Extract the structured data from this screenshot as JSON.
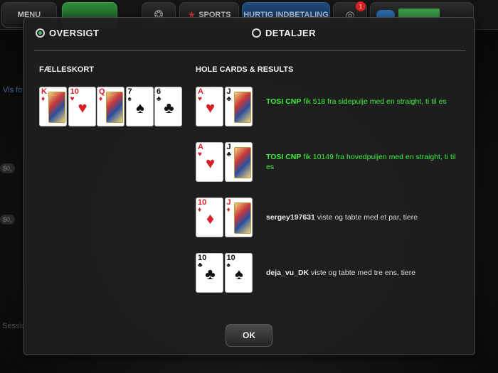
{
  "topbar": {
    "menu_label": "MENU",
    "sports_label": "SPORTS",
    "quick_deposit_label": "HURTIG INDBETALING",
    "notification_count": "1"
  },
  "background": {
    "show_link": "Vis fo",
    "session_label": "Sessio",
    "chip_left_1": "$0,",
    "chip_left_2": "$0,"
  },
  "dialog": {
    "tabs": [
      {
        "label": "OVERSIGT",
        "selected": true
      },
      {
        "label": "DETALJER",
        "selected": false
      }
    ],
    "board_heading": "FÆLLESKORT",
    "hole_heading": "HOLE CARDS & RESULTS",
    "board_cards": [
      {
        "rank": "K",
        "suit": "♦",
        "color": "red",
        "face": true
      },
      {
        "rank": "10",
        "suit": "♥",
        "color": "red",
        "face": false
      },
      {
        "rank": "Q",
        "suit": "♦",
        "color": "red",
        "face": true
      },
      {
        "rank": "7",
        "suit": "♠",
        "color": "blk",
        "face": false
      },
      {
        "rank": "6",
        "suit": "♣",
        "color": "blk",
        "face": false
      }
    ],
    "results": [
      {
        "cards": [
          {
            "rank": "A",
            "suit": "♥",
            "color": "red",
            "face": false
          },
          {
            "rank": "J",
            "suit": "♣",
            "color": "blk",
            "face": true
          }
        ],
        "player": "TOSI CNP",
        "text": " fik 518 fra sidepulje med en straight, ti til es",
        "winner": true
      },
      {
        "cards": [
          {
            "rank": "A",
            "suit": "♥",
            "color": "red",
            "face": false
          },
          {
            "rank": "J",
            "suit": "♣",
            "color": "blk",
            "face": true
          }
        ],
        "player": "TOSI CNP",
        "text": " fik 10149 fra hovedpuljen med en straight, ti til es",
        "winner": true
      },
      {
        "cards": [
          {
            "rank": "10",
            "suit": "♦",
            "color": "red",
            "face": false
          },
          {
            "rank": "J",
            "suit": "♦",
            "color": "red",
            "face": true
          }
        ],
        "player": "sergey197631",
        "text": " viste og tabte med et par, tiere",
        "winner": false
      },
      {
        "cards": [
          {
            "rank": "10",
            "suit": "♣",
            "color": "blk",
            "face": false
          },
          {
            "rank": "10",
            "suit": "♠",
            "color": "blk",
            "face": false
          }
        ],
        "player": "deja_vu_DK",
        "text": " viste og tabte med tre ens, tiere",
        "winner": false
      }
    ],
    "ok_label": "OK"
  }
}
